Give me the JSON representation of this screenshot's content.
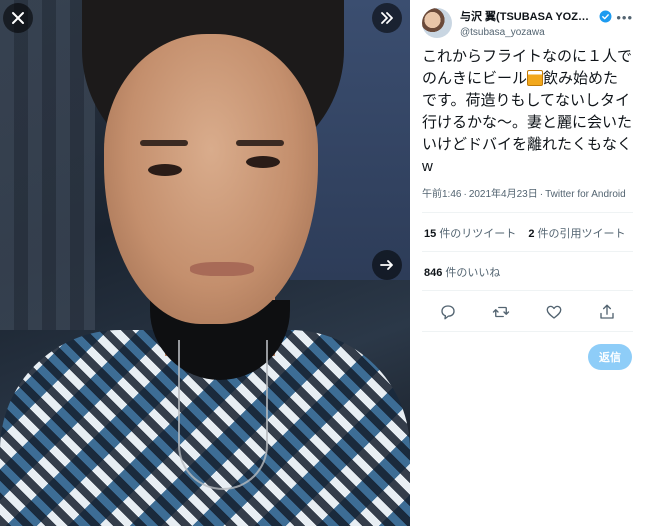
{
  "viewer": {
    "close_icon": "close-icon",
    "collapse_icon": "double-chevron-right-icon",
    "next_icon": "arrow-right-icon"
  },
  "tweet": {
    "display_name": "与沢 翼(TSUBASA YOZA…",
    "handle": "@tsubasa_yozawa",
    "verified": true,
    "text_part1": "これからフライトなのに１人でのんきにビール",
    "emoji": "beer-mug-emoji",
    "text_part2": "飲み始めたです。荷造りもしてないしタイ行けるかな〜。妻と麗に会いたいけどドバイを離れたくもなくw",
    "time": "午前1:46",
    "date": "2021年4月23日",
    "source": "Twitter for Android",
    "separator": "·",
    "retweets_count": "15",
    "retweets_label": "件のリツイート",
    "quotes_count": "2",
    "quotes_label": "件の引用ツイート",
    "likes_count": "846",
    "likes_label": "件のいいね",
    "reply_button": "返信"
  },
  "colors": {
    "accent": "#1d9bf0",
    "reply_button_disabled": "#8ecdf8",
    "secondary_text": "#536471"
  }
}
